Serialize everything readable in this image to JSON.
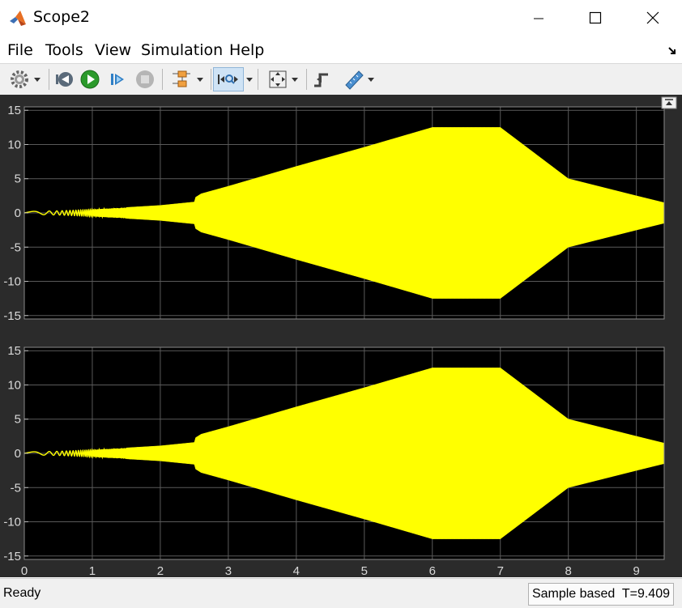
{
  "window": {
    "title": "Scope2"
  },
  "menu": {
    "items": [
      "File",
      "Tools",
      "View",
      "Simulation",
      "Help"
    ]
  },
  "toolbar": {
    "icons": [
      "gear-icon",
      "step-back-icon",
      "run-icon",
      "step-forward-icon",
      "stop-icon",
      "signal-select-icon",
      "zoom-icon",
      "fit-icon",
      "trigger-icon",
      "measure-icon"
    ]
  },
  "status": {
    "left": "Ready",
    "right": "Sample based  T=9.409"
  },
  "colors": {
    "trace": "#ffff00",
    "axes_bg": "#000000",
    "figure_bg": "#2b2b2b",
    "grid": "#5a5a5a",
    "tick_text": "#d9d9d9"
  },
  "chart_data": [
    {
      "type": "line",
      "title": "",
      "xlabel": "",
      "ylabel": "",
      "xlim": [
        0,
        9.409
      ],
      "ylim": [
        -15.5,
        15.5
      ],
      "xticks": [
        0,
        1,
        2,
        3,
        4,
        5,
        6,
        7,
        8,
        9
      ],
      "yticks": [
        15,
        10,
        5,
        0,
        -5,
        -10,
        -15
      ],
      "grid": true,
      "envelope": {
        "t": [
          0,
          0.5,
          1.0,
          1.5,
          2.0,
          2.5,
          2.52,
          2.6,
          3.0,
          4.0,
          5.0,
          6.0,
          7.0,
          8.0,
          9.0,
          9.409
        ],
        "amp": [
          0.2,
          0.3,
          0.5,
          0.8,
          1.1,
          1.6,
          2.3,
          2.8,
          3.9,
          6.8,
          9.6,
          12.5,
          12.5,
          5.0,
          2.5,
          1.5
        ]
      },
      "series": [
        {
          "values_description": ""
        }
      ]
    },
    {
      "type": "line",
      "title": "",
      "xlabel": "",
      "ylabel": "",
      "xlim": [
        0,
        9.409
      ],
      "ylim": [
        -15.5,
        15.5
      ],
      "xticks": [
        0,
        1,
        2,
        3,
        4,
        5,
        6,
        7,
        8,
        9
      ],
      "yticks": [
        15,
        10,
        5,
        0,
        -5,
        -10,
        -15
      ],
      "grid": true,
      "envelope": {
        "t": [
          0,
          0.5,
          1.0,
          1.5,
          2.0,
          2.5,
          2.52,
          2.6,
          3.0,
          4.0,
          5.0,
          6.0,
          7.0,
          8.0,
          9.0,
          9.409
        ],
        "amp": [
          0.2,
          0.3,
          0.5,
          0.8,
          1.1,
          1.6,
          2.3,
          2.8,
          3.9,
          6.8,
          9.6,
          12.5,
          12.5,
          5.0,
          2.5,
          1.5
        ]
      }
    }
  ]
}
